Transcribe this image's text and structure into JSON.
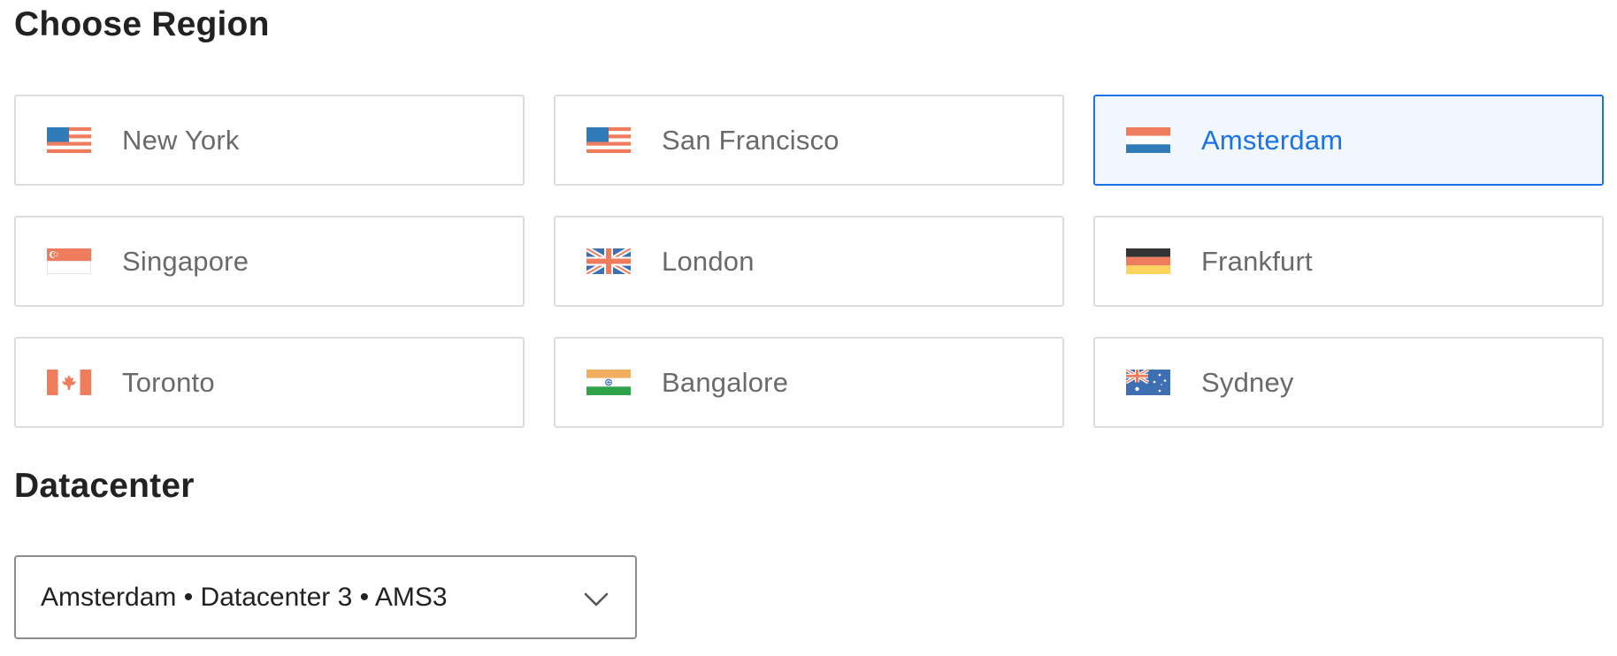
{
  "region_section": {
    "title": "Choose Region",
    "selected": "Amsterdam",
    "regions": [
      {
        "label": "New York",
        "flag": "us-flag-icon"
      },
      {
        "label": "San Francisco",
        "flag": "us-flag-icon"
      },
      {
        "label": "Amsterdam",
        "flag": "netherlands-flag-icon",
        "selected": true
      },
      {
        "label": "Singapore",
        "flag": "singapore-flag-icon"
      },
      {
        "label": "London",
        "flag": "uk-flag-icon"
      },
      {
        "label": "Frankfurt",
        "flag": "germany-flag-icon"
      },
      {
        "label": "Toronto",
        "flag": "canada-flag-icon"
      },
      {
        "label": "Bangalore",
        "flag": "india-flag-icon"
      },
      {
        "label": "Sydney",
        "flag": "australia-flag-icon"
      }
    ]
  },
  "datacenter_section": {
    "title": "Datacenter",
    "selected_value": "Amsterdam • Datacenter 3 • AMS3",
    "dropdown_icon": "chevron-down-icon"
  },
  "colors": {
    "accent": "#1a74e8",
    "selected_background": "#f2f7fe",
    "card_border": "#dddddd",
    "label_text": "#6a6a6a",
    "heading_text": "#222222"
  }
}
